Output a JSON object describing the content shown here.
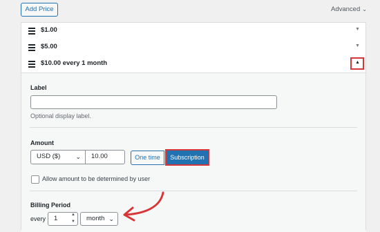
{
  "toolbar": {
    "add_price_label": "Add Price",
    "advanced_label": "Advanced"
  },
  "prices": [
    {
      "label": "$1.00"
    },
    {
      "label": "$5.00"
    },
    {
      "label": "$10.00 every 1 month"
    }
  ],
  "form": {
    "label_title": "Label",
    "label_value": "",
    "label_help": "Optional display label.",
    "amount_title": "Amount",
    "currency": "USD ($)",
    "amount_value": "10.00",
    "type_one_time": "One time",
    "type_subscription": "Subscription",
    "allow_custom_label": "Allow amount to be determined by user",
    "billing_title": "Billing Period",
    "every_label": "every",
    "interval_value": "1",
    "period_value": "month"
  },
  "colors": {
    "accent": "#2271b1",
    "highlight": "#d63638"
  }
}
